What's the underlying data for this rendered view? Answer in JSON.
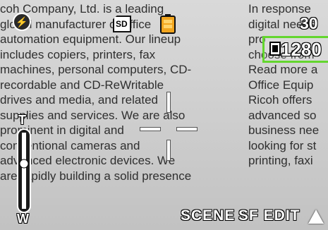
{
  "viewfinder": {
    "left_column_lines": [
      "coh Company, Ltd. is a leading",
      "global manufacturer of office",
      "automation equipment. Our lineup",
      "includes copiers, printers, fax",
      "machines, personal computers, CD-",
      "recordable and CD-ReWritable",
      "drives and media, and related",
      "supplies and services. We are also",
      "prominent in digital and",
      "conventional cameras and",
      "advanced electronic devices. We",
      "are rapidly building a solid presence"
    ],
    "right_column_lines": [
      "In response",
      "digital needs",
      "pro",
      "choose from",
      "Read more a",
      "Office Equip",
      "Ricoh offers",
      "advanced so",
      "business nee",
      "looking for st",
      "printing, faxi",
      ""
    ]
  },
  "overlay": {
    "flash_icon_name": "flash-off-icon",
    "flash_glyph": "⚡",
    "card_label": "SD",
    "battery_icon_name": "battery-icon",
    "shots_remaining": "30",
    "resolution_value": "1280",
    "resolution_highlight_color": "#63d62e",
    "zoom_tele_label": "T",
    "zoom_wide_label": "W",
    "zoom_level": 0.6,
    "scene_label": "SCENE",
    "sf_edit_label": "SF EDIT",
    "menu_up_icon_name": "triangle-up-icon"
  }
}
